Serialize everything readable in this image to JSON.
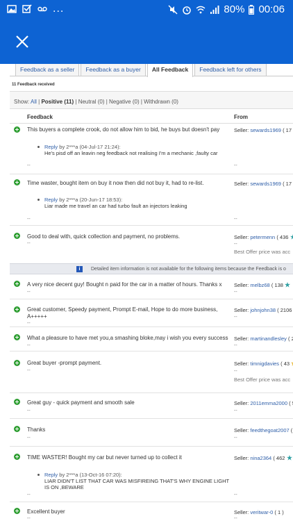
{
  "status_bar": {
    "battery": "80%",
    "time": "00:06",
    "dots": "..."
  },
  "app_bar": {
    "close_icon": "close-icon"
  },
  "tabs": [
    {
      "label": "Feedback as a seller",
      "active": false
    },
    {
      "label": "Feedback as a buyer",
      "active": false
    },
    {
      "label": "All Feedback",
      "active": true
    },
    {
      "label": "Feedback left for others",
      "active": false
    }
  ],
  "feedback_count": "11 Feedback received",
  "filter": {
    "show_label": "Show:",
    "all": "All",
    "positive": "Positive (11)",
    "neutral": "Neutral (0)",
    "negative": "Negative (0)",
    "withdrawn": "Withdrawn (0)",
    "sep": "|"
  },
  "table_header": {
    "feedback": "Feedback",
    "from": "From"
  },
  "notice_text": "Detailed item information is not available for the following items because the Feedback is o",
  "rows": [
    {
      "comment": "This buyers a complete crook, do not allow him to bid, he buys but doesn't pay",
      "reply_label": "Reply",
      "reply_meta": "by 2***a (04-Jul-17 21:24):",
      "reply_body": "He's pisd off an leavin neg feedback not realising I'm a mechanic ,faulty car",
      "seller_prefix": "Seller:",
      "seller_name": "sewards1969",
      "seller_score": "( 17 •",
      "dash": "--",
      "dash2": "--"
    },
    {
      "comment": "Time waster, bought item on buy it now then did not buy it, had to re-list.",
      "reply_label": "Reply",
      "reply_meta": "by 2***a (20-Jun-17 18:53):",
      "reply_body": "Liar made me travel an car had turbo fault an injectors leaking",
      "seller_prefix": "Seller:",
      "seller_name": "sewards1969",
      "seller_score": "( 17 •",
      "dash": "--",
      "dash2": "--"
    },
    {
      "comment": "Good to deal with, quick collection and payment, no problems.",
      "seller_prefix": "Seller:",
      "seller_name": "petermenn",
      "seller_score": "( 436",
      "dash": "--",
      "dash2": "--",
      "extra": "Best Offer price was acc"
    },
    {
      "comment": "A very nice decent guy! Bought n paid for the car in a matter of hours. Thanks x",
      "seller_prefix": "Seller:",
      "seller_name": "melbz68",
      "seller_score": "( 138",
      "dash": "--",
      "dash2": "--"
    },
    {
      "comment": "Great customer, Speedy payment, Prompt E-mail, Hope to do more business, A+++++",
      "seller_prefix": "Seller:",
      "seller_name": "johnjohn38",
      "seller_score": "( 2106",
      "dash": "--",
      "dash2": "--"
    },
    {
      "comment": "What a pleasure to have met you,a smashing bloke,may i wish you every success",
      "seller_prefix": "Seller:",
      "seller_name": "martinandlesley",
      "seller_score": "( 2",
      "dash": "--",
      "dash2": "--"
    },
    {
      "comment": "Great buyer -prompt payment.",
      "seller_prefix": "Seller:",
      "seller_name": "timnigdavies",
      "seller_score": "( 43",
      "dash": "--",
      "dash2": "--",
      "extra": "Best Offer price was acc"
    },
    {
      "comment": "Great guy - quick payment and smooth sale",
      "seller_prefix": "Seller:",
      "seller_name": "2011emma2000",
      "seller_score": "( 5",
      "dash": "--",
      "dash2": "--"
    },
    {
      "comment": "Thanks",
      "seller_prefix": "Seller:",
      "seller_name": "feedthegoat2007",
      "seller_score": "( 1",
      "dash": "--",
      "dash2": "--"
    },
    {
      "comment": "TIME WASTER! Bought my car but never turned up to collect it",
      "reply_label": "Reply",
      "reply_meta": "by 2***a (13-Oct-16 07:20):",
      "reply_body": "LIAR DIDN'T LIST THAT CAR WAS MISFIREING THAT'S WHY ENGINE LIGHT IS ON ,BEWARE",
      "seller_prefix": "Seller:",
      "seller_name": "nina2364",
      "seller_score": "( 462",
      "dash": "--",
      "dash2": "--"
    },
    {
      "comment": "Excellent buyer",
      "seller_prefix": "Seller:",
      "seller_name": "veritwar-0",
      "seller_score": "( 1 )",
      "dash": "--",
      "dash2": "--"
    }
  ]
}
